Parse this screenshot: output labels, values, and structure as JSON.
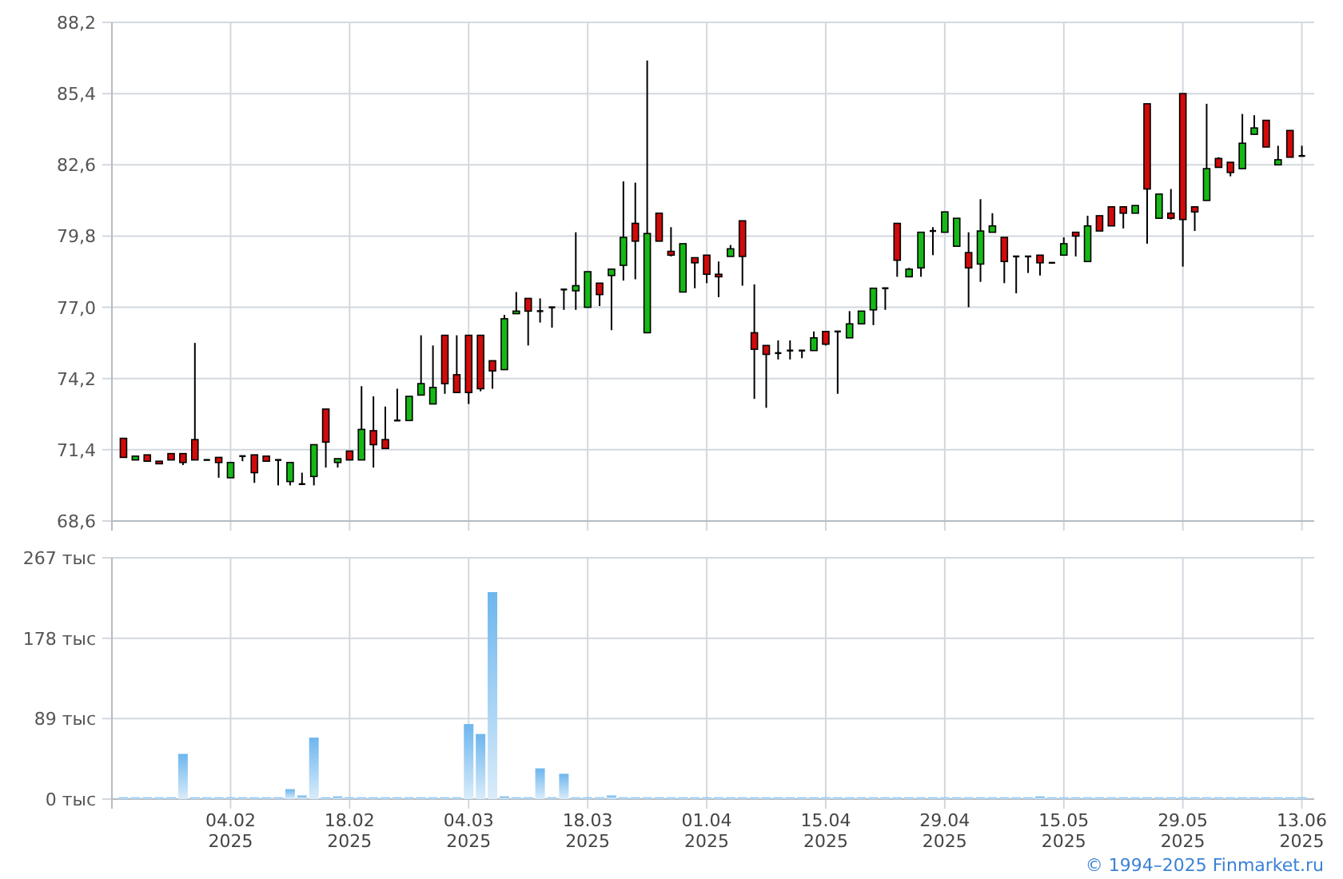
{
  "price_chart": {
    "chart_data": {
      "type": "candlestick",
      "grid": true,
      "ylim": [
        68.6,
        88.2
      ],
      "yticks": [
        {
          "value": 88.2,
          "label": "88,2"
        },
        {
          "value": 85.4,
          "label": "85,4"
        },
        {
          "value": 82.6,
          "label": "82,6"
        },
        {
          "value": 79.8,
          "label": "79,8"
        },
        {
          "value": 77.0,
          "label": "77,0"
        },
        {
          "value": 74.2,
          "label": "74,2"
        },
        {
          "value": 71.4,
          "label": "71,4"
        },
        {
          "value": 68.6,
          "label": "68,6"
        }
      ],
      "categories": [
        null,
        null,
        null,
        null,
        null,
        null,
        null,
        null,
        null,
        null,
        null,
        null,
        null,
        null,
        null,
        null,
        null,
        null,
        null,
        null,
        null,
        null,
        null,
        null,
        null,
        null,
        null,
        null,
        null,
        null,
        null,
        null,
        null,
        null,
        null,
        null,
        null,
        null,
        null,
        null,
        null,
        null,
        null,
        null,
        null,
        null,
        null,
        null,
        null,
        null,
        null,
        null,
        null,
        null,
        null,
        null,
        null,
        null,
        null,
        null,
        null,
        null,
        null,
        null,
        null,
        null,
        null,
        null,
        null,
        null,
        null,
        null,
        null,
        null,
        null,
        null,
        null,
        null,
        null,
        null,
        null,
        null,
        null,
        null,
        null,
        null,
        null,
        null,
        null,
        null,
        null,
        null,
        null,
        null,
        null,
        null,
        null,
        null,
        null,
        null
      ],
      "ohlc": [
        [
          71.85,
          71.85,
          71.1,
          71.1
        ],
        [
          71.0,
          71.15,
          71.0,
          71.15
        ],
        [
          71.2,
          71.2,
          70.95,
          70.95
        ],
        [
          70.95,
          70.95,
          70.85,
          70.85
        ],
        [
          71.25,
          71.25,
          71.0,
          71.0
        ],
        [
          71.25,
          71.25,
          70.8,
          70.9
        ],
        [
          71.8,
          75.6,
          71.0,
          71.0
        ],
        [
          71.0,
          71.0,
          71.0,
          71.0
        ],
        [
          71.1,
          71.1,
          70.3,
          70.9
        ],
        [
          70.3,
          70.9,
          70.3,
          70.9
        ],
        [
          71.15,
          71.15,
          70.95,
          71.15
        ],
        [
          71.2,
          71.2,
          70.1,
          70.5
        ],
        [
          71.15,
          71.15,
          70.95,
          70.95
        ],
        [
          71.0,
          71.0,
          70.0,
          71.0
        ],
        [
          70.15,
          70.9,
          70.0,
          70.9
        ],
        [
          70.05,
          70.5,
          70.05,
          70.05
        ],
        [
          70.35,
          71.6,
          70.0,
          71.6
        ],
        [
          73.0,
          73.0,
          70.7,
          71.7
        ],
        [
          70.9,
          71.05,
          70.7,
          71.05
        ],
        [
          71.35,
          71.35,
          71.0,
          71.0
        ],
        [
          71.0,
          73.9,
          71.0,
          72.2
        ],
        [
          72.15,
          73.5,
          70.7,
          71.6
        ],
        [
          71.8,
          73.1,
          71.45,
          71.45
        ],
        [
          72.55,
          73.8,
          72.55,
          72.55
        ],
        [
          72.55,
          73.5,
          72.55,
          73.5
        ],
        [
          73.55,
          75.9,
          73.55,
          74.0
        ],
        [
          73.2,
          75.5,
          73.2,
          73.85
        ],
        [
          75.9,
          75.9,
          73.6,
          74.0
        ],
        [
          74.35,
          75.9,
          73.65,
          73.65
        ],
        [
          75.9,
          75.9,
          73.2,
          73.65
        ],
        [
          75.9,
          75.9,
          73.7,
          73.8
        ],
        [
          74.9,
          74.9,
          73.8,
          74.5
        ],
        [
          74.55,
          76.7,
          74.55,
          76.55
        ],
        [
          76.75,
          77.6,
          76.75,
          76.85
        ],
        [
          77.35,
          77.35,
          75.5,
          76.85
        ],
        [
          76.85,
          77.35,
          76.4,
          76.85
        ],
        [
          77.0,
          77.0,
          76.2,
          77.0
        ],
        [
          77.7,
          77.7,
          76.9,
          77.7
        ],
        [
          77.65,
          79.95,
          76.9,
          77.85
        ],
        [
          77.0,
          78.4,
          77.0,
          78.4
        ],
        [
          77.95,
          77.95,
          77.05,
          77.5
        ],
        [
          78.25,
          78.5,
          76.1,
          78.5
        ],
        [
          78.65,
          81.95,
          78.05,
          79.75
        ],
        [
          80.3,
          81.9,
          78.1,
          79.6
        ],
        [
          76.0,
          86.7,
          76.0,
          79.9
        ],
        [
          80.7,
          80.7,
          79.6,
          79.6
        ],
        [
          79.2,
          80.15,
          79.0,
          79.05
        ],
        [
          77.6,
          79.5,
          77.6,
          79.5
        ],
        [
          78.95,
          78.95,
          77.75,
          78.75
        ],
        [
          79.05,
          79.05,
          77.95,
          78.3
        ],
        [
          78.3,
          78.8,
          77.4,
          78.2
        ],
        [
          79.0,
          79.45,
          79.0,
          79.3
        ],
        [
          80.4,
          80.4,
          77.85,
          79.0
        ],
        [
          76.0,
          77.9,
          73.4,
          75.35
        ],
        [
          75.5,
          75.5,
          73.05,
          75.15
        ],
        [
          75.2,
          75.7,
          74.95,
          75.2
        ],
        [
          75.3,
          75.7,
          74.95,
          75.3
        ],
        [
          75.3,
          75.3,
          75.0,
          75.3
        ],
        [
          75.3,
          76.05,
          75.3,
          75.8
        ],
        [
          76.05,
          76.05,
          75.5,
          75.55
        ],
        [
          76.05,
          76.05,
          73.6,
          76.05
        ],
        [
          75.8,
          76.85,
          75.8,
          76.35
        ],
        [
          76.35,
          76.85,
          76.35,
          76.85
        ],
        [
          76.9,
          77.75,
          76.3,
          77.75
        ],
        [
          77.75,
          77.75,
          76.9,
          77.75
        ],
        [
          80.3,
          80.3,
          78.2,
          78.85
        ],
        [
          78.2,
          78.55,
          78.2,
          78.5
        ],
        [
          78.55,
          79.95,
          78.2,
          79.95
        ],
        [
          80.0,
          80.15,
          79.05,
          80.0
        ],
        [
          79.95,
          80.75,
          79.95,
          80.75
        ],
        [
          79.4,
          80.5,
          79.4,
          80.5
        ],
        [
          79.15,
          79.95,
          77.0,
          78.55
        ],
        [
          78.7,
          81.25,
          78.0,
          80.0
        ],
        [
          79.95,
          80.7,
          79.95,
          80.2
        ],
        [
          79.75,
          79.75,
          77.95,
          78.8
        ],
        [
          79.0,
          79.0,
          77.55,
          79.0
        ],
        [
          79.0,
          79.0,
          78.35,
          79.0
        ],
        [
          79.05,
          79.05,
          78.25,
          78.75
        ],
        [
          78.75,
          78.75,
          78.75,
          78.75
        ],
        [
          79.05,
          79.75,
          79.05,
          79.5
        ],
        [
          79.95,
          79.95,
          79.0,
          79.8
        ],
        [
          78.8,
          80.6,
          78.8,
          80.2
        ],
        [
          80.6,
          80.6,
          80.0,
          80.0
        ],
        [
          80.95,
          80.95,
          80.2,
          80.2
        ],
        [
          80.95,
          80.95,
          80.1,
          80.7
        ],
        [
          80.7,
          81.0,
          80.7,
          81.0
        ],
        [
          85.0,
          85.0,
          79.5,
          81.65
        ],
        [
          80.5,
          81.45,
          80.5,
          81.45
        ],
        [
          80.7,
          81.65,
          80.45,
          80.5
        ],
        [
          85.4,
          85.4,
          78.6,
          80.45
        ],
        [
          80.95,
          80.95,
          80.0,
          80.75
        ],
        [
          81.2,
          85.0,
          81.2,
          82.45
        ],
        [
          82.85,
          82.9,
          82.5,
          82.5
        ],
        [
          82.7,
          82.7,
          82.15,
          82.3
        ],
        [
          82.45,
          84.6,
          82.45,
          83.45
        ],
        [
          83.8,
          84.55,
          83.8,
          84.05
        ],
        [
          84.35,
          84.35,
          83.3,
          83.3
        ],
        [
          82.6,
          83.35,
          82.6,
          82.8
        ],
        [
          83.95,
          83.95,
          82.9,
          82.9
        ],
        [
          82.95,
          83.35,
          82.95,
          82.95
        ]
      ]
    }
  },
  "volume_chart": {
    "chart_data": {
      "type": "bar",
      "grid": true,
      "ylim": [
        0,
        267
      ],
      "yticks": [
        {
          "value": 267,
          "label": "267 тыс"
        },
        {
          "value": 178,
          "label": "178 тыс"
        },
        {
          "value": 89,
          "label": "89 тыс"
        },
        {
          "value": 0,
          "label": "0 тыс"
        }
      ],
      "categories": [
        null,
        null,
        null,
        null,
        null,
        null,
        null,
        null,
        null,
        "04.02\n2025",
        null,
        null,
        null,
        null,
        null,
        null,
        null,
        null,
        null,
        "18.02\n2025",
        null,
        null,
        null,
        null,
        null,
        null,
        null,
        null,
        null,
        "04.03\n2025",
        null,
        null,
        null,
        null,
        null,
        null,
        null,
        null,
        null,
        "18.03\n2025",
        null,
        null,
        null,
        null,
        null,
        null,
        null,
        null,
        null,
        "01.04\n2025",
        null,
        null,
        null,
        null,
        null,
        null,
        null,
        null,
        null,
        "15.04\n2025",
        null,
        null,
        null,
        null,
        null,
        null,
        null,
        null,
        null,
        "29.04\n2025",
        null,
        null,
        null,
        null,
        null,
        null,
        null,
        null,
        null,
        "15.05\n2025",
        null,
        null,
        null,
        null,
        null,
        null,
        null,
        null,
        null,
        "29.05\n2025",
        null,
        null,
        null,
        null,
        null,
        null,
        null,
        null,
        null,
        "13.06\n2025"
      ],
      "values": [
        2,
        2,
        2,
        2,
        2,
        50,
        2,
        2,
        2,
        2,
        2,
        2,
        2,
        2,
        11,
        4,
        68,
        2,
        3,
        2,
        2,
        2,
        2,
        2,
        2,
        2,
        2,
        2,
        2,
        83,
        72,
        229,
        3,
        2,
        2,
        34,
        2,
        28,
        2,
        2,
        2,
        4,
        2,
        2,
        2,
        2,
        2,
        2,
        2,
        2,
        2,
        2,
        2,
        2,
        2,
        2,
        2,
        2,
        2,
        2,
        2,
        2,
        2,
        2,
        2,
        2,
        2,
        2,
        2,
        2,
        2,
        2,
        2,
        2,
        2,
        2,
        2,
        3,
        2,
        2,
        2,
        2,
        2,
        2,
        2,
        2,
        2,
        2,
        2,
        2,
        2,
        2,
        2,
        2,
        2,
        2,
        2,
        2,
        2,
        2
      ]
    }
  },
  "footer": {
    "copyright": "© 1994–2025 Finmarket.ru"
  }
}
